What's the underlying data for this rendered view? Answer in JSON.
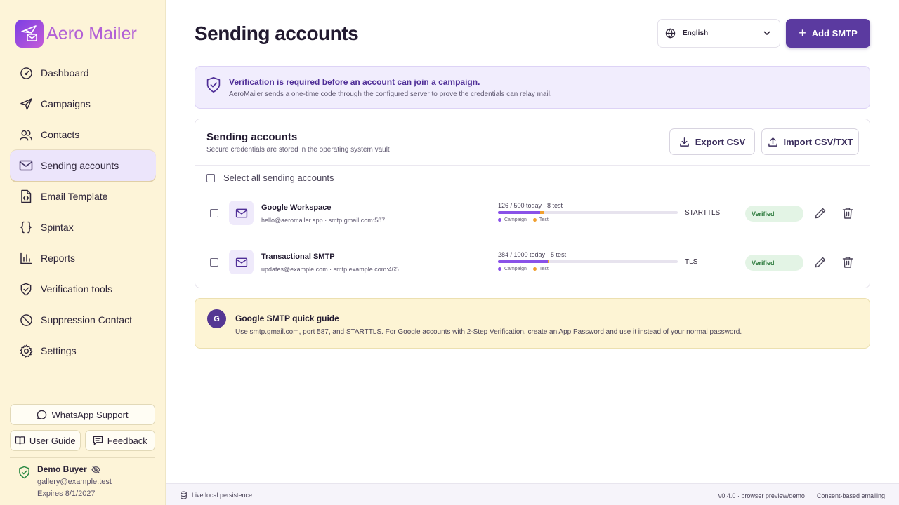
{
  "brand": {
    "name": "Aero Mailer"
  },
  "nav": {
    "dashboard": "Dashboard",
    "campaigns": "Campaigns",
    "contacts": "Contacts",
    "sending_accounts": "Sending accounts",
    "email_template": "Email Template",
    "spintax": "Spintax",
    "reports": "Reports",
    "verification_tools": "Verification tools",
    "suppression_contact": "Suppression Contact",
    "settings": "Settings"
  },
  "sidebar_buttons": {
    "whatsapp": "WhatsApp Support",
    "user_guide": "User Guide",
    "feedback": "Feedback"
  },
  "user": {
    "name": "Demo Buyer",
    "email": "gallery@example.test",
    "expires": "Expires 8/1/2027"
  },
  "header": {
    "title": "Sending accounts",
    "language": "English",
    "add_smtp": "Add SMTP"
  },
  "banner": {
    "title": "Verification is required before an account can join a campaign.",
    "description": "AeroMailer sends a one-time code through the configured server to prove the credentials can relay mail."
  },
  "accounts_card": {
    "title": "Sending accounts",
    "subtitle": "Secure credentials are stored in the operating system vault",
    "export_label": "Export CSV",
    "import_label": "Import CSV/TXT",
    "select_all": "Select all sending accounts",
    "legend_campaign": "Campaign",
    "legend_test": "Test",
    "rows": [
      {
        "name": "Google Workspace",
        "host": "hello@aeromailer.app · smtp.gmail.com:587",
        "usage": "126 / 500 today · 8 test",
        "campaign_fraction": 0.236,
        "test_fraction": 0.016,
        "security": "STARTTLS",
        "status": "Verified"
      },
      {
        "name": "Transactional SMTP",
        "host": "updates@example.com · smtp.example.com:465",
        "usage": "284 / 1000 today · 5 test",
        "campaign_fraction": 0.279,
        "test_fraction": 0.005,
        "security": "TLS",
        "status": "Verified"
      }
    ]
  },
  "guide": {
    "avatar": "G",
    "title": "Google SMTP quick guide",
    "text": "Use smtp.gmail.com, port 587, and STARTTLS. For Google accounts with 2-Step Verification, create an App Password and use it instead of your normal password."
  },
  "footer": {
    "persistence": "Live local persistence",
    "version": "v0.4.0 · browser preview/demo",
    "consent": "Consent-based emailing"
  },
  "colors": {
    "accent": "#5b3aa0",
    "sidebar_bg": "#fdf4d8",
    "campaign_bar": "#8a52e8",
    "test_bar": "#f0a030",
    "verified": "#2c7a3c"
  }
}
